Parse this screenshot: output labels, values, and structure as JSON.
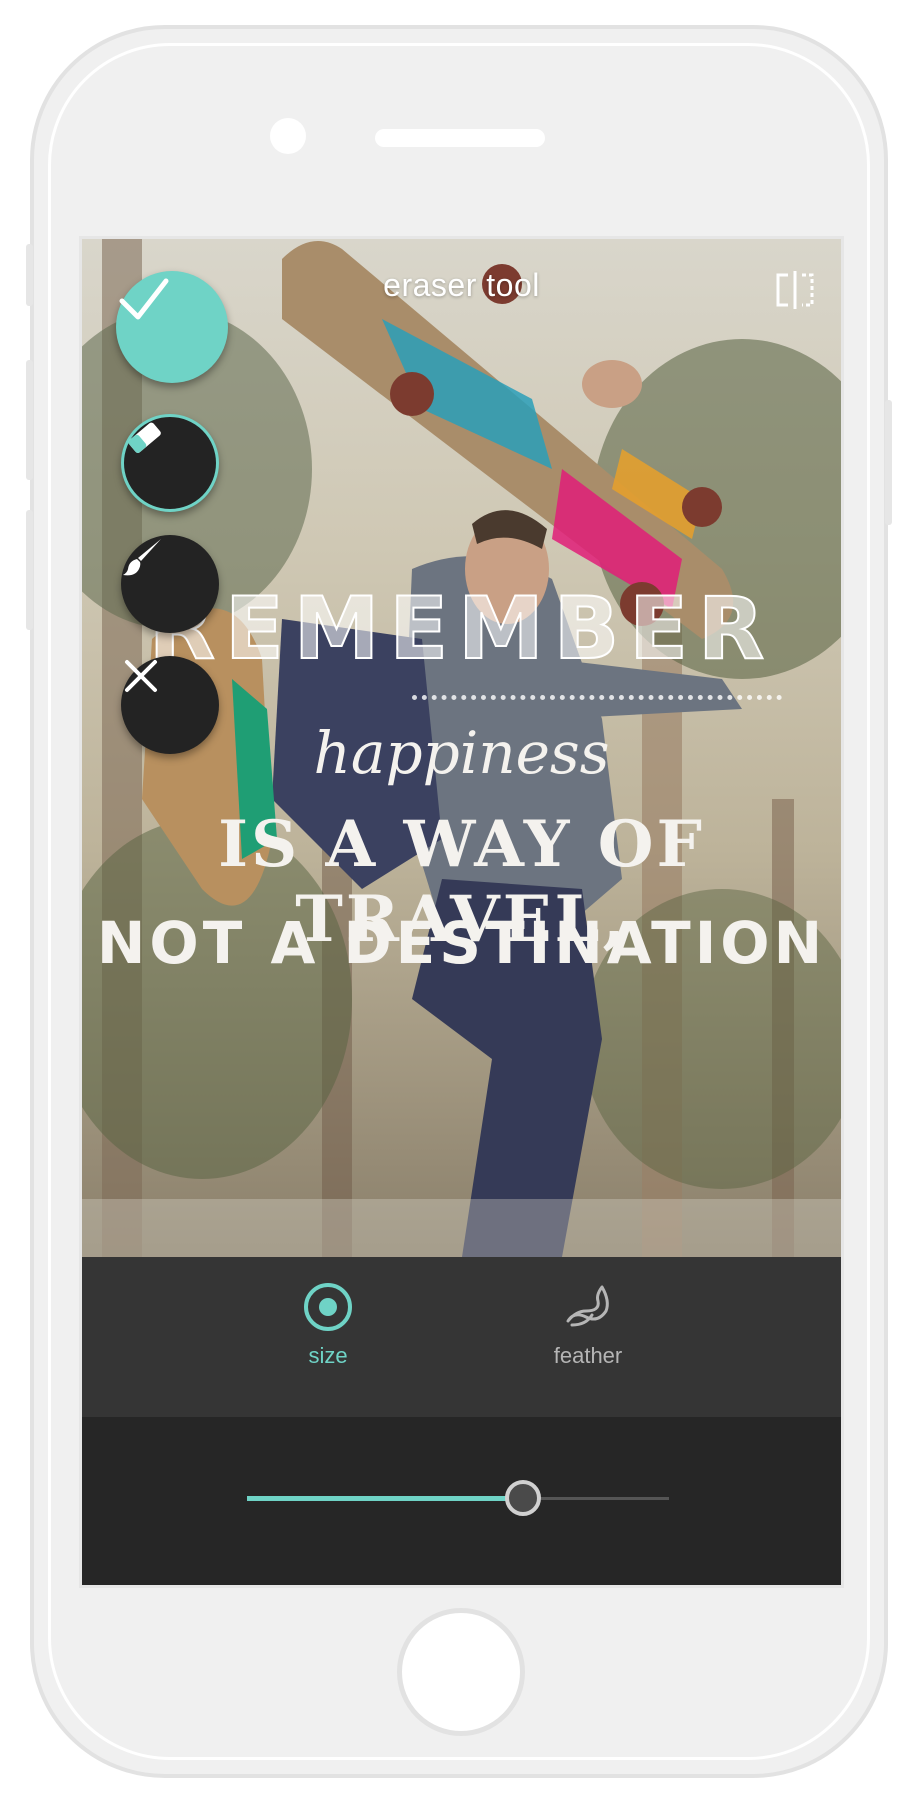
{
  "header": {
    "title": "eraser tool",
    "compare_icon": "compare-split-icon"
  },
  "actions": [
    {
      "name": "done",
      "icon": "checkmark-icon"
    },
    {
      "name": "eraser",
      "icon": "eraser-icon",
      "selected": true
    },
    {
      "name": "brush",
      "icon": "brush-icon"
    },
    {
      "name": "close",
      "icon": "close-icon"
    }
  ],
  "canvas": {
    "quote_lines": [
      "REMEMBER",
      "happiness",
      "IS A WAY OF TRAVEL,",
      "NOT A DESTINATION"
    ]
  },
  "tools": {
    "size": {
      "label": "size",
      "icon": "radio-target-icon",
      "active": true
    },
    "feather": {
      "label": "feather",
      "icon": "feather-icon",
      "active": false
    }
  },
  "slider": {
    "value": 0.655
  },
  "colors": {
    "accent": "#6fd3c6",
    "panel": "#353535",
    "dark": "#262626"
  }
}
